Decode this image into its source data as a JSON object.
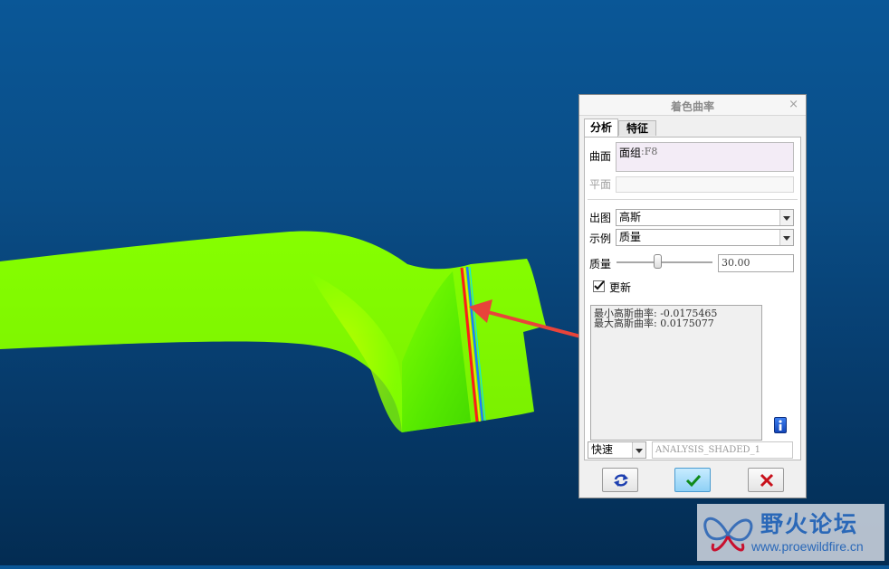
{
  "dialog": {
    "title": "着色曲率",
    "close_glyph": "×",
    "tabs": [
      {
        "label": "分析"
      },
      {
        "label": "特征"
      }
    ],
    "surface": {
      "label": "曲面",
      "value_prefix": "面组",
      "value_suffix": ":F8"
    },
    "plane": {
      "label": "平面"
    },
    "output": {
      "label": "出图",
      "value": "高斯"
    },
    "example": {
      "label": "示例",
      "value": "质量"
    },
    "quality": {
      "label": "质量",
      "value": "30.00",
      "slider_fraction": 0.43
    },
    "update": {
      "label": "更新",
      "checked": true
    },
    "results": {
      "line1": "最小高斯曲率: -0.0175465",
      "line2": "最大高斯曲率: 0.0175077"
    },
    "mode": {
      "value": "快速"
    },
    "analysis_name": "ANALYSIS_SHADED_1"
  },
  "watermark": {
    "title": "野火论坛",
    "url": "www.proewildfire.cn"
  },
  "colors": {
    "accent_green": "#7cfc00",
    "viewport_bg": "#0a4d86",
    "arrow": "#e8443a"
  }
}
